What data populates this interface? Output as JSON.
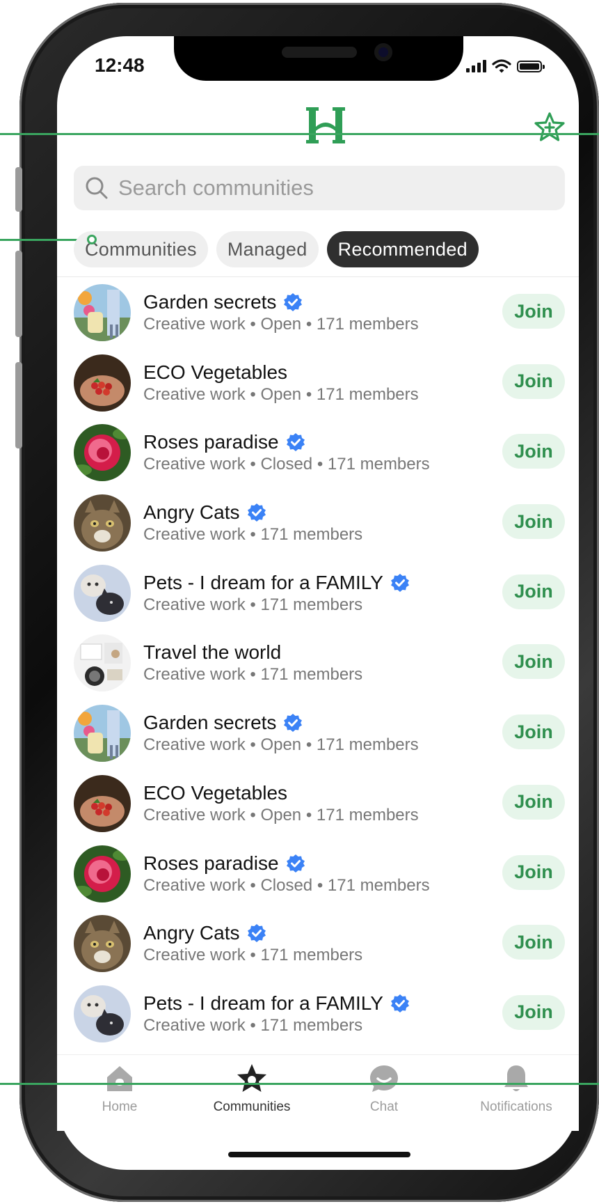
{
  "status_bar": {
    "time": "12:48"
  },
  "header": {
    "logo": "H",
    "logo_icon": "brand-logo",
    "action_icon": "star-add-icon",
    "accent": "#2f9e56"
  },
  "search": {
    "placeholder": "Search communities",
    "value": ""
  },
  "filters": [
    {
      "label": "Communities",
      "active": false
    },
    {
      "label": "Managed",
      "active": false
    },
    {
      "label": "Recommended",
      "active": true
    }
  ],
  "communities": [
    {
      "name": "Garden secrets",
      "verified": true,
      "meta": "Creative work • Open • 171 members",
      "action": "Join",
      "image": "garden"
    },
    {
      "name": "ECO Vegetables",
      "verified": false,
      "meta": "Creative work •  Open • 171 members",
      "action": "Join",
      "image": "vegetables"
    },
    {
      "name": "Roses paradise",
      "verified": true,
      "meta": "Creative work • Closed • 171 members",
      "action": "Join",
      "image": "rose"
    },
    {
      "name": "Angry Cats",
      "verified": true,
      "meta": "Creative work • 171 members",
      "action": "Join",
      "image": "cat"
    },
    {
      "name": "Pets - I dream for a FAMILY",
      "verified": true,
      "meta": "Creative work • 171 members",
      "action": "Join",
      "image": "pets"
    },
    {
      "name": "Travel the world",
      "verified": false,
      "meta": "Creative work • 171 members",
      "action": "Join",
      "image": "travel"
    },
    {
      "name": "Garden secrets",
      "verified": true,
      "meta": "Creative work • Open • 171 members",
      "action": "Join",
      "image": "garden"
    },
    {
      "name": "ECO Vegetables",
      "verified": false,
      "meta": "Creative work •  Open • 171 members",
      "action": "Join",
      "image": "vegetables"
    },
    {
      "name": "Roses paradise",
      "verified": true,
      "meta": "Creative work • Closed • 171 members",
      "action": "Join",
      "image": "rose"
    },
    {
      "name": "Angry Cats",
      "verified": true,
      "meta": "Creative work • 171 members",
      "action": "Join",
      "image": "cat"
    },
    {
      "name": "Pets - I dream for a FAMILY",
      "verified": true,
      "meta": "Creative work • 171 members",
      "action": "Join",
      "image": "pets"
    }
  ],
  "tabbar": {
    "items": [
      {
        "label": "Home",
        "icon": "home-icon",
        "active": false
      },
      {
        "label": "Communities",
        "icon": "communities-star-icon",
        "active": true
      },
      {
        "label": "Chat",
        "icon": "chat-icon",
        "active": false
      },
      {
        "label": "Notifications",
        "icon": "bell-icon",
        "active": false
      }
    ]
  },
  "colors": {
    "join_bg": "#e6f5ea",
    "join_text": "#2f8f4e",
    "verified": "#3b82f6",
    "chip_active": "#2f2f2f"
  }
}
